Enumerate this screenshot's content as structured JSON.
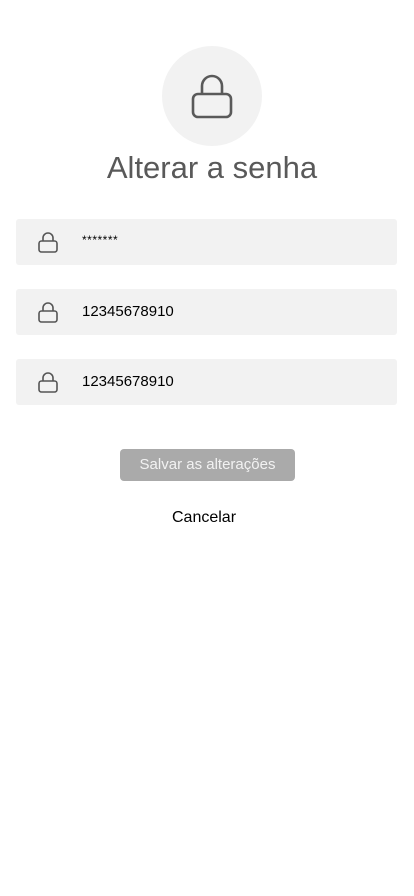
{
  "header": {
    "icon": "lock-icon",
    "title": "Alterar a senha"
  },
  "fields": [
    {
      "icon": "lock-icon",
      "value": "*******"
    },
    {
      "icon": "lock-icon",
      "value": "12345678910"
    },
    {
      "icon": "lock-icon",
      "value": "12345678910"
    }
  ],
  "actions": {
    "save_label": "Salvar as alterações",
    "cancel_label": "Cancelar"
  },
  "colors": {
    "field_background": "#f2f2f2",
    "title": "#595959",
    "save_button_background": "#aaaaaa"
  }
}
